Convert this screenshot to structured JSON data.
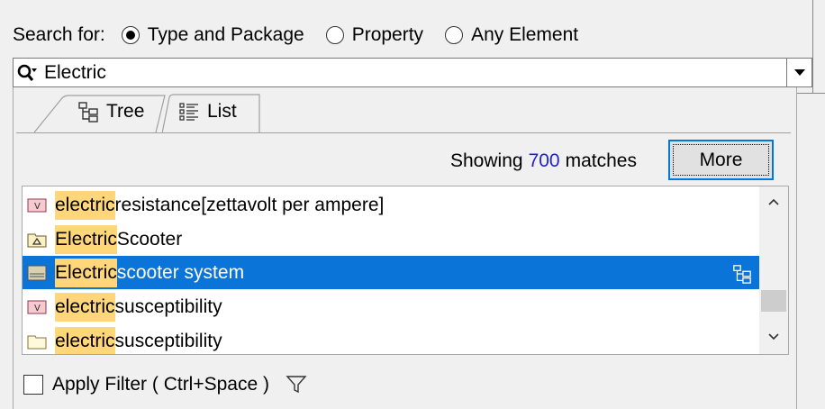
{
  "search": {
    "label": "Search for:",
    "options": [
      {
        "label": "Type and Package",
        "selected": true
      },
      {
        "label": "Property",
        "selected": false
      },
      {
        "label": "Any Element",
        "selected": false
      }
    ],
    "query": "Electric"
  },
  "tabs": [
    {
      "label": "Tree",
      "active": false,
      "icon": "tree-icon"
    },
    {
      "label": "List",
      "active": true,
      "icon": "list-icon"
    }
  ],
  "results": {
    "showing_prefix": "Showing",
    "count": "700",
    "showing_suffix": "matches",
    "more_label": "More"
  },
  "list": {
    "items": [
      {
        "highlight": "electric",
        "rest": "resistance[zettavolt per ampere]",
        "icon": "value-type-icon",
        "selected": false
      },
      {
        "highlight": "Electric",
        "rest": "Scooter",
        "icon": "package-icon",
        "selected": false
      },
      {
        "highlight": "Electric",
        "rest": "scooter system",
        "icon": "block-icon",
        "selected": true
      },
      {
        "highlight": "electric",
        "rest": "susceptibility",
        "icon": "value-type-icon",
        "selected": false
      },
      {
        "highlight": "electric",
        "rest": "susceptibility",
        "icon": "folder-icon",
        "selected": false
      }
    ]
  },
  "filter": {
    "label": "Apply Filter ( Ctrl+Space )",
    "checked": false
  },
  "colors": {
    "selection": "#0a74d9",
    "highlight": "#ffd77a",
    "count_text": "#1f1fd6",
    "focus_border": "#0078d7"
  }
}
